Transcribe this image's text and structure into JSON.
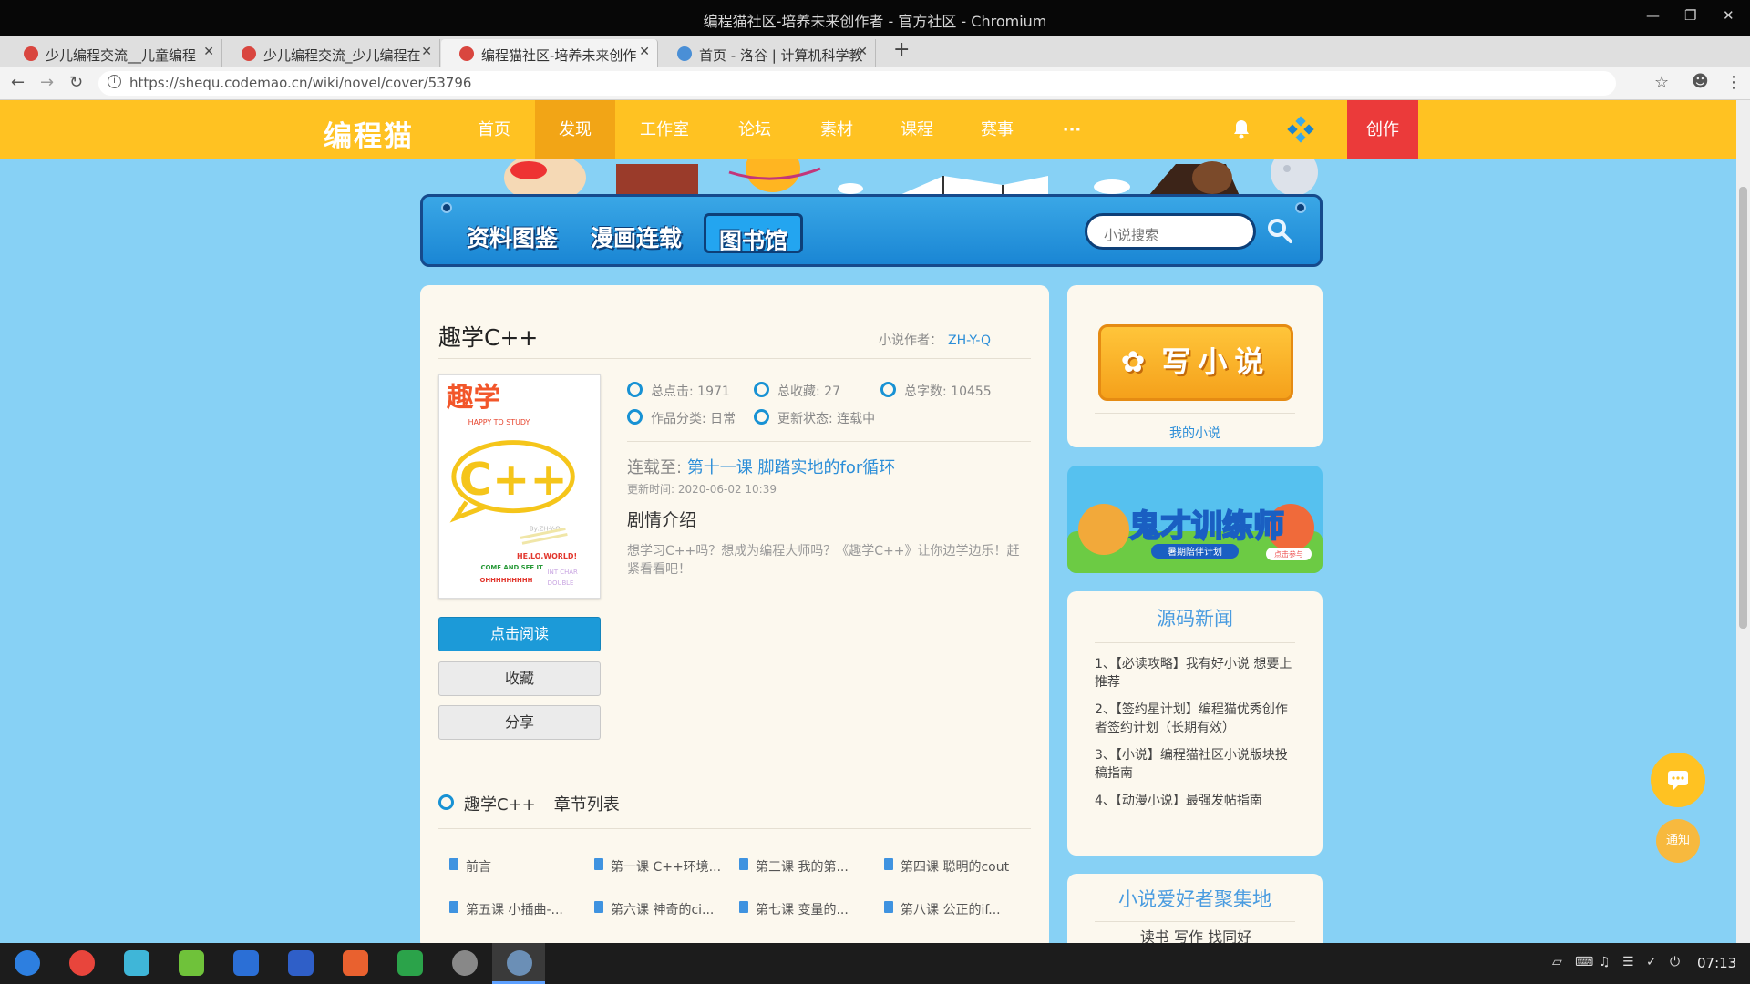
{
  "window": {
    "title": "编程猫社区-培养未来创作者 - 官方社区 - Chromium"
  },
  "tabs": [
    {
      "label": "少儿编程交流__儿童编程"
    },
    {
      "label": "少儿编程交流_少儿编程在"
    },
    {
      "label": "编程猫社区-培养未来创作"
    },
    {
      "label": "首页 - 洛谷 | 计算机科学教"
    }
  ],
  "address": {
    "url": "https://shequ.codemao.cn/wiki/novel/cover/53796"
  },
  "site": {
    "logo": "编程猫",
    "nav": [
      "首页",
      "发现",
      "工作室",
      "论坛",
      "素材",
      "课程",
      "赛事",
      "···"
    ],
    "create": "创作"
  },
  "library": {
    "tabs": [
      "资料图鉴",
      "漫画连载",
      "图书馆"
    ],
    "search_placeholder": "小说搜索"
  },
  "novel": {
    "title": "趣学C++",
    "author_label": "小说作者：",
    "author": "ZH-Y-Q",
    "stats": [
      "总点击: 1971",
      "总收藏: 27",
      "总字数: 10455",
      "作品分类: 日常",
      "更新状态: 连载中"
    ],
    "serial_label": "连载至:",
    "latest_chapter": "第十一课 脚踏实地的for循环",
    "update_time": "更新时间: 2020-06-02 10:39",
    "plot_heading": "剧情介绍",
    "plot": "想学习C++吗？想成为编程大师吗？《趣学C++》让你边学边乐！赶紧看看吧！",
    "cover": {
      "title": "趣学",
      "subtitle": "HAPPY TO STUDY",
      "big": "C++",
      "by": "By:ZH-Y-Q",
      "hello": "HE,LO,WORLD!",
      "come": "COME AND SEE IT",
      "types": "INT CHAR",
      "types2": "DOUBLE",
      "hash": "OHHHHHHHHH"
    },
    "buttons": {
      "read": "点击阅读",
      "collect": "收藏",
      "share": "分享"
    },
    "chapters_heading": "趣学C++",
    "chapters_label": "章节列表",
    "chapters": [
      "前言",
      "第一课 C++环境...",
      "第三课 我的第...",
      "第四课 聪明的cout",
      "第五课 小插曲-...",
      "第六课 神奇的ci...",
      "第七课 变量的...",
      "第八课 公正的if..."
    ]
  },
  "sidebar": {
    "write_label": "写小说",
    "my_novel": "我的小说",
    "news_title": "源码新闻",
    "news": [
      "1、【必读攻略】我有好小说 想要上推荐",
      "2、【签约星计划】编程猫优秀创作者签约计划（长期有效）",
      "3、【小说】编程猫社区小说版块投稿指南",
      "4、【动漫小说】最强发帖指南"
    ],
    "fans_title": "小说爱好者聚集地",
    "fans_links": "读书  写作  找同好",
    "banner_text": "鬼才训练师",
    "banner_sub": "暑期陪伴计划",
    "banner_badge": "点击参与"
  },
  "float": {
    "notify": "通知"
  },
  "taskbar": {
    "time": "07:13"
  }
}
